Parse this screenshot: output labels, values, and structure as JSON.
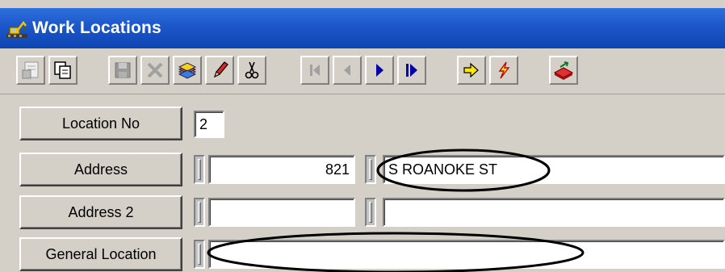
{
  "window": {
    "title": "Work Locations",
    "title_icon": "excavator-app-icon"
  },
  "toolbar": {
    "buttons": [
      {
        "name": "properties-icon"
      },
      {
        "name": "copy-record-icon"
      },
      {
        "name": "save-icon"
      },
      {
        "name": "delete-icon"
      },
      {
        "name": "add-record-icon"
      },
      {
        "name": "edit-pencil-icon"
      },
      {
        "name": "cut-icon"
      },
      {
        "name": "first-record-icon"
      },
      {
        "name": "previous-record-icon"
      },
      {
        "name": "next-record-icon"
      },
      {
        "name": "last-record-icon"
      },
      {
        "name": "go-arrow-icon"
      },
      {
        "name": "lightning-icon"
      },
      {
        "name": "exit-icon"
      }
    ]
  },
  "form": {
    "location_no": {
      "label": "Location No",
      "value": "2"
    },
    "address": {
      "label": "Address",
      "number": "821",
      "street": "S ROANOKE ST"
    },
    "address2": {
      "label": "Address 2",
      "number": "",
      "street": ""
    },
    "general_location": {
      "label": "General Location",
      "value": ""
    }
  },
  "colors": {
    "titlebar": "#0e45b4",
    "face": "#d4d0c8"
  }
}
